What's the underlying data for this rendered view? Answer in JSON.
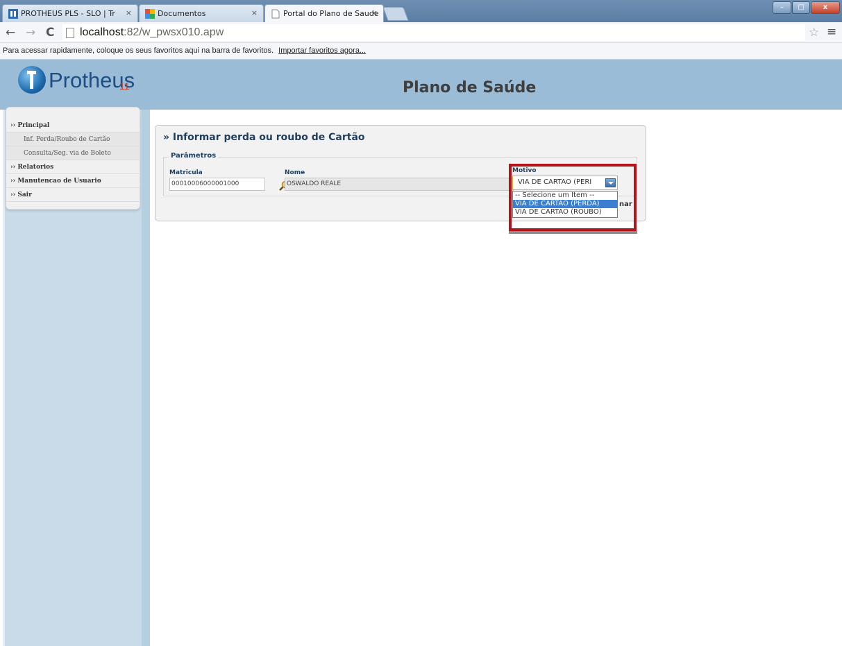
{
  "browser": {
    "tabs": [
      {
        "label": "PROTHEUS PLS - SLO | Tr",
        "close": "×"
      },
      {
        "label": "Documentos",
        "close": "×"
      },
      {
        "label": "Portal do Plano de Saude",
        "close": "×"
      }
    ],
    "window_buttons": {
      "minimize": "–",
      "maximize": "□",
      "close": "x"
    },
    "nav": {
      "back": "←",
      "forward": "→",
      "reload": "C"
    },
    "url_host": "localhost",
    "url_path": ":82/w_pwsx010.apw",
    "bookmarks_text": "Para acessar rapidamente, coloque os seus favoritos aqui na barra de favoritos.",
    "bookmarks_link": "Importar favoritos agora...",
    "star": "☆",
    "menu": "≡"
  },
  "header": {
    "logo_text": "Protheus",
    "logo_version": "11",
    "title": "Plano de Saúde"
  },
  "sidebar": {
    "items": [
      {
        "label": "›› Principal"
      },
      {
        "label": "Inf. Perda/Roubo de Cartão"
      },
      {
        "label": "Consulta/Seg. via de Boleto"
      },
      {
        "label": "›› Relatorios"
      },
      {
        "label": "›› Manutencao de Usuario"
      },
      {
        "label": "›› Sair"
      }
    ]
  },
  "form": {
    "title": "» Informar perda ou roubo de Cartão",
    "legend": "Parâmetros",
    "matricula_label": "Matricula",
    "matricula_value": "00010006000001000",
    "nome_label": "Nome",
    "nome_value": "OSWALDO REALE",
    "motivo_label": "Motivo",
    "motivo_selected": "VIA DE CARTAO (PERI",
    "motivo_options": [
      "-- Selecione um Item --",
      "VIA DE CARTAO (PERDA)",
      "VIA DE CARTAO (ROUBO)"
    ],
    "confirm_label": "nar"
  },
  "colors": {
    "header_bg": "#9bbcd6",
    "highlight": "#b3141b",
    "selected_option": "#3b7fd3"
  }
}
